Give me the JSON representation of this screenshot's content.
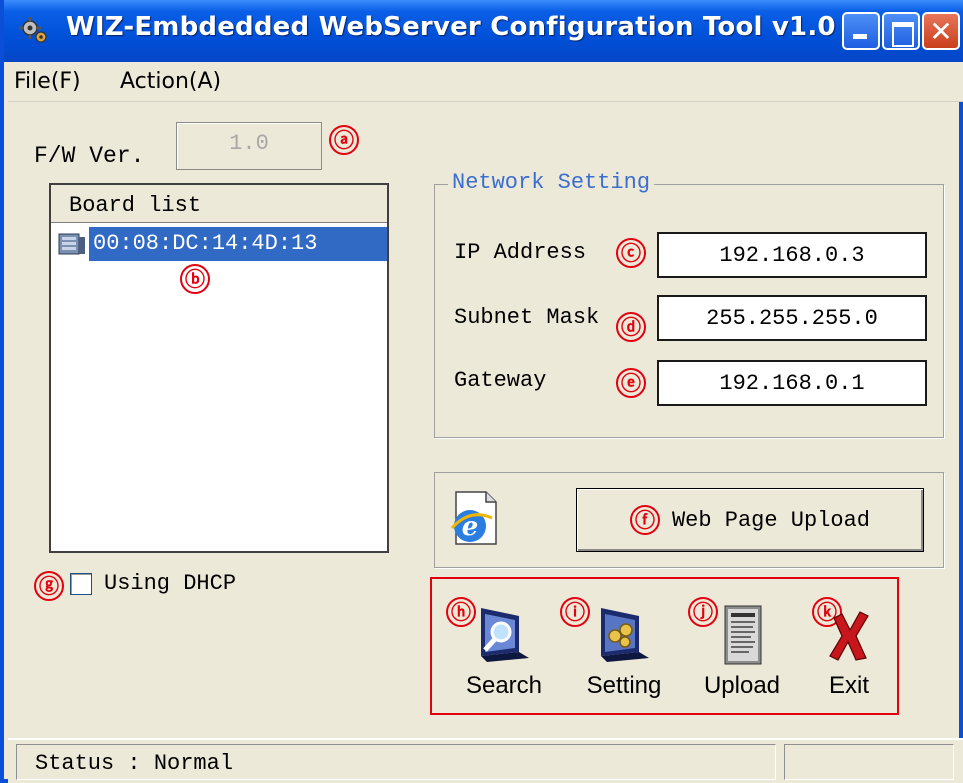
{
  "window": {
    "title": "WIZ-Embdedded WebServer Configuration Tool v1.0",
    "icon": "gear-app-icon"
  },
  "menu": {
    "items": [
      {
        "label": "File(F)"
      },
      {
        "label": "Action(A)"
      }
    ]
  },
  "firmware": {
    "label": "F/W Ver.",
    "value": "1.0",
    "marker": "ⓐ"
  },
  "board_list": {
    "header": "Board list",
    "items": [
      {
        "mac": "00:08:DC:14:4D:13",
        "selected": true,
        "icon": "network-node-icon"
      }
    ],
    "marker": "ⓑ"
  },
  "network": {
    "title": "Network Setting",
    "fields": [
      {
        "label": "IP Address",
        "value": "192.168.0.3",
        "marker": "ⓒ"
      },
      {
        "label": "Subnet Mask",
        "value": "255.255.255.0",
        "marker": "ⓓ"
      },
      {
        "label": "Gateway",
        "value": "192.168.0.1",
        "marker": "ⓔ"
      }
    ]
  },
  "web_upload": {
    "label": "Web Page Upload",
    "marker": "ⓕ",
    "icon": "internet-explorer-icon"
  },
  "dhcp": {
    "label": "Using DHCP",
    "checked": false,
    "marker": "ⓖ"
  },
  "actions": [
    {
      "label": "Search",
      "marker": "ⓗ",
      "icon": "search-monitor-icon"
    },
    {
      "label": "Setting",
      "marker": "ⓘ",
      "icon": "setting-monitor-icon"
    },
    {
      "label": "Upload",
      "marker": "ⓙ",
      "icon": "readme-document-icon"
    },
    {
      "label": "Exit",
      "marker": "ⓚ",
      "icon": "red-x-icon"
    }
  ],
  "status": {
    "text": "Status : Normal"
  },
  "colors": {
    "title_bar": "#0050d8",
    "window_bg": "#ece9d8",
    "selection": "#316ac5",
    "annotation_red": "#e3000f",
    "group_title_blue": "#3c6ecf"
  }
}
